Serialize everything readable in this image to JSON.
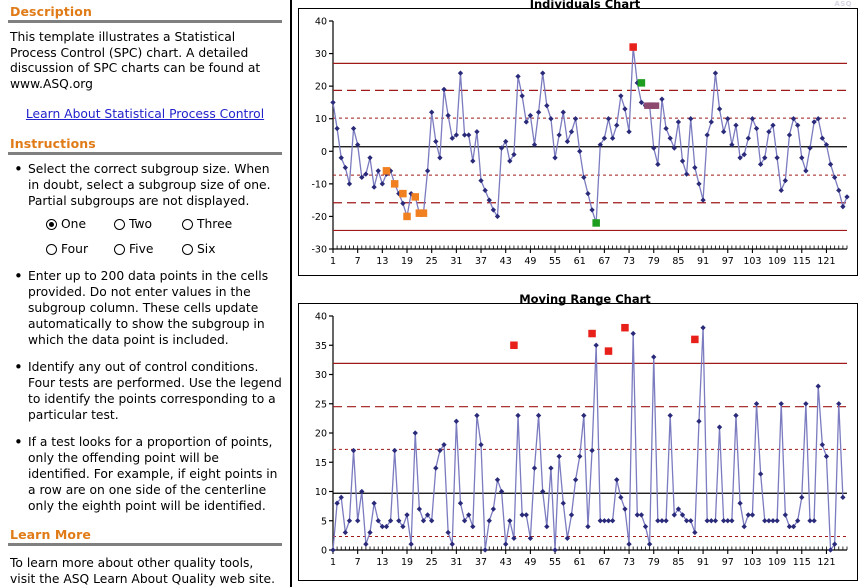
{
  "sidebar": {
    "description_heading": "Description",
    "description_text": "This template illustrates a Statistical Process Control (SPC) chart.  A detailed discussion of SPC charts can be found at www.ASQ.org",
    "learn_link": "Learn About Statistical Process Control",
    "instructions_heading": "Instructions",
    "instructions": [
      "Select the correct subgroup size. When in doubt, select a subgroup size of one. Partial subgroups are not displayed.",
      "Enter up to 200 data points in the cells provided. Do not enter values in the subgroup column.  These cells update automatically to show the subgroup in which the data point is included.",
      "Identify any out of control conditions.  Four tests are performed.  Use the legend to identify the points corresponding to a particular test.",
      "If a test looks for a proportion of points, only the offending point will be identified.  For example, if eight points in a row are on one side of the centerline only the eighth point will be identified."
    ],
    "subgroup_options": [
      {
        "label": "One",
        "selected": true
      },
      {
        "label": "Two",
        "selected": false
      },
      {
        "label": "Three",
        "selected": false
      },
      {
        "label": "Four",
        "selected": false
      },
      {
        "label": "Five",
        "selected": false
      },
      {
        "label": "Six",
        "selected": false
      }
    ],
    "learn_more_heading": "Learn More",
    "learn_more_text": "To learn more about other quality tools, visit the ASQ Learn About Quality web site."
  },
  "colors": {
    "heading": "#E07B18",
    "link": "#2222CC",
    "series": "#2A2A7A",
    "series_line": "#7B7BC0",
    "control_limit": "#A01A1A",
    "center_line": "#000000",
    "test1": "#E8201A",
    "test2": "#F08020",
    "test3": "#1E9E1E",
    "test4": "#8E4A6E"
  },
  "chart_data": [
    {
      "type": "line",
      "name": "individuals-chart",
      "title": "Individuals Chart",
      "xlabel": "",
      "ylabel": "",
      "ylim": [
        -30,
        40
      ],
      "yticks": [
        -30,
        -20,
        -10,
        0,
        10,
        20,
        30,
        40
      ],
      "xlim": [
        1,
        126
      ],
      "xticks": [
        1,
        7,
        13,
        19,
        25,
        31,
        37,
        43,
        49,
        55,
        61,
        67,
        73,
        79,
        85,
        91,
        97,
        103,
        109,
        115,
        121
      ],
      "grid": false,
      "control_lines": [
        {
          "label": "UCL",
          "value": 27.0,
          "style": "solid"
        },
        {
          "label": "+2s",
          "value": 18.7,
          "style": "dashed"
        },
        {
          "label": "+1s",
          "value": 10.2,
          "style": "dotted"
        },
        {
          "label": "CL",
          "value": 1.4,
          "style": "center"
        },
        {
          "label": "-1s",
          "value": -7.3,
          "style": "dotted"
        },
        {
          "label": "-2s",
          "value": -15.8,
          "style": "dashed"
        },
        {
          "label": "LCL",
          "value": -24.3,
          "style": "solid"
        }
      ],
      "values": [
        15,
        7,
        -2,
        -5,
        -10,
        7,
        2,
        -8,
        -7,
        -2,
        -11,
        -6,
        -10,
        -7,
        -6,
        -10,
        -13,
        -16,
        -20,
        -13,
        -14,
        -19,
        -19,
        -6,
        12,
        3,
        -2,
        19,
        11,
        4,
        5,
        24,
        5,
        5,
        -3,
        6,
        -9,
        -12,
        -15,
        -18,
        -20,
        1,
        3,
        -3,
        -1,
        23,
        17,
        9,
        11,
        2,
        12,
        24,
        14,
        10,
        -2,
        5,
        12,
        3,
        6,
        10,
        0,
        -8,
        -13,
        -18,
        -22,
        2,
        4,
        10,
        4,
        8,
        17,
        13,
        6,
        32,
        21,
        15,
        14,
        14,
        1,
        -4,
        16,
        7,
        4,
        1,
        9,
        -3,
        -7,
        10,
        -5,
        -10,
        -15,
        5,
        9,
        24,
        13,
        6,
        10,
        2,
        8,
        -2,
        -1,
        4,
        10,
        7,
        -4,
        -2,
        6,
        8,
        -2,
        -12,
        -9,
        5,
        10,
        8,
        -2,
        -6,
        1,
        9,
        10,
        4,
        2,
        -4,
        -8,
        -12,
        -17,
        -14
      ],
      "special_points": [
        {
          "x": 14,
          "y": -6,
          "test": "test2"
        },
        {
          "x": 16,
          "y": -10,
          "test": "test2"
        },
        {
          "x": 18,
          "y": -13,
          "test": "test2"
        },
        {
          "x": 19,
          "y": -20,
          "test": "test2"
        },
        {
          "x": 21,
          "y": -14,
          "test": "test2"
        },
        {
          "x": 22,
          "y": -19,
          "test": "test2"
        },
        {
          "x": 23,
          "y": -19,
          "test": "test2"
        },
        {
          "x": 65,
          "y": -22,
          "test": "test3"
        },
        {
          "x": 74,
          "y": 32,
          "test": "test1"
        },
        {
          "x": 76,
          "y": 21,
          "test": "test3"
        },
        {
          "x": 78,
          "y": 14,
          "test": "test4"
        },
        {
          "x": 79,
          "y": 14,
          "test": "test4"
        }
      ]
    },
    {
      "type": "line",
      "name": "moving-range-chart",
      "title": "Moving Range Chart",
      "xlabel": "",
      "ylabel": "",
      "ylim": [
        0,
        40
      ],
      "yticks": [
        0,
        5,
        10,
        15,
        20,
        25,
        30,
        35,
        40
      ],
      "xlim": [
        1,
        126
      ],
      "xticks": [
        1,
        7,
        13,
        19,
        25,
        31,
        37,
        43,
        49,
        55,
        61,
        67,
        73,
        79,
        85,
        91,
        97,
        103,
        109,
        115,
        121
      ],
      "grid": false,
      "control_lines": [
        {
          "label": "UCL",
          "value": 31.9,
          "style": "solid"
        },
        {
          "label": "+2s",
          "value": 24.5,
          "style": "dashed"
        },
        {
          "label": "+1s",
          "value": 17.2,
          "style": "dotted"
        },
        {
          "label": "CL",
          "value": 9.7,
          "style": "center"
        },
        {
          "label": "-1s",
          "value": 2.3,
          "style": "dotted"
        }
      ],
      "values": [
        0,
        8,
        9,
        3,
        5,
        17,
        5,
        10,
        1,
        3,
        8,
        5,
        4,
        4,
        5,
        17,
        5,
        4,
        6,
        1,
        20,
        7,
        5,
        6,
        5,
        14,
        17,
        18,
        3,
        1,
        22,
        8,
        5,
        6,
        4,
        23,
        18,
        0,
        5,
        7,
        12,
        10,
        1,
        5,
        2,
        23,
        6,
        6,
        2,
        14,
        23,
        10,
        4,
        14,
        0,
        16,
        8,
        2,
        6,
        12,
        16,
        23,
        4,
        17,
        35,
        5,
        5,
        5,
        5,
        12,
        9,
        7,
        1,
        37,
        6,
        6,
        4,
        1,
        33,
        5,
        5,
        5,
        23,
        6,
        7,
        6,
        5,
        5,
        3,
        22,
        38,
        5,
        5,
        5,
        21,
        5,
        5,
        5,
        23,
        8,
        4,
        6,
        6,
        25,
        13,
        5,
        5,
        5,
        5,
        25,
        6,
        4,
        4,
        5,
        9,
        25,
        5,
        5,
        28,
        18,
        16,
        0,
        1,
        25,
        9
      ],
      "special_points": [
        {
          "x": 45,
          "y": 35,
          "test": "test1"
        },
        {
          "x": 64,
          "y": 37,
          "test": "test1"
        },
        {
          "x": 68,
          "y": 34,
          "test": "test1"
        },
        {
          "x": 72,
          "y": 38,
          "test": "test1"
        },
        {
          "x": 89,
          "y": 36,
          "test": "test1"
        }
      ]
    }
  ]
}
